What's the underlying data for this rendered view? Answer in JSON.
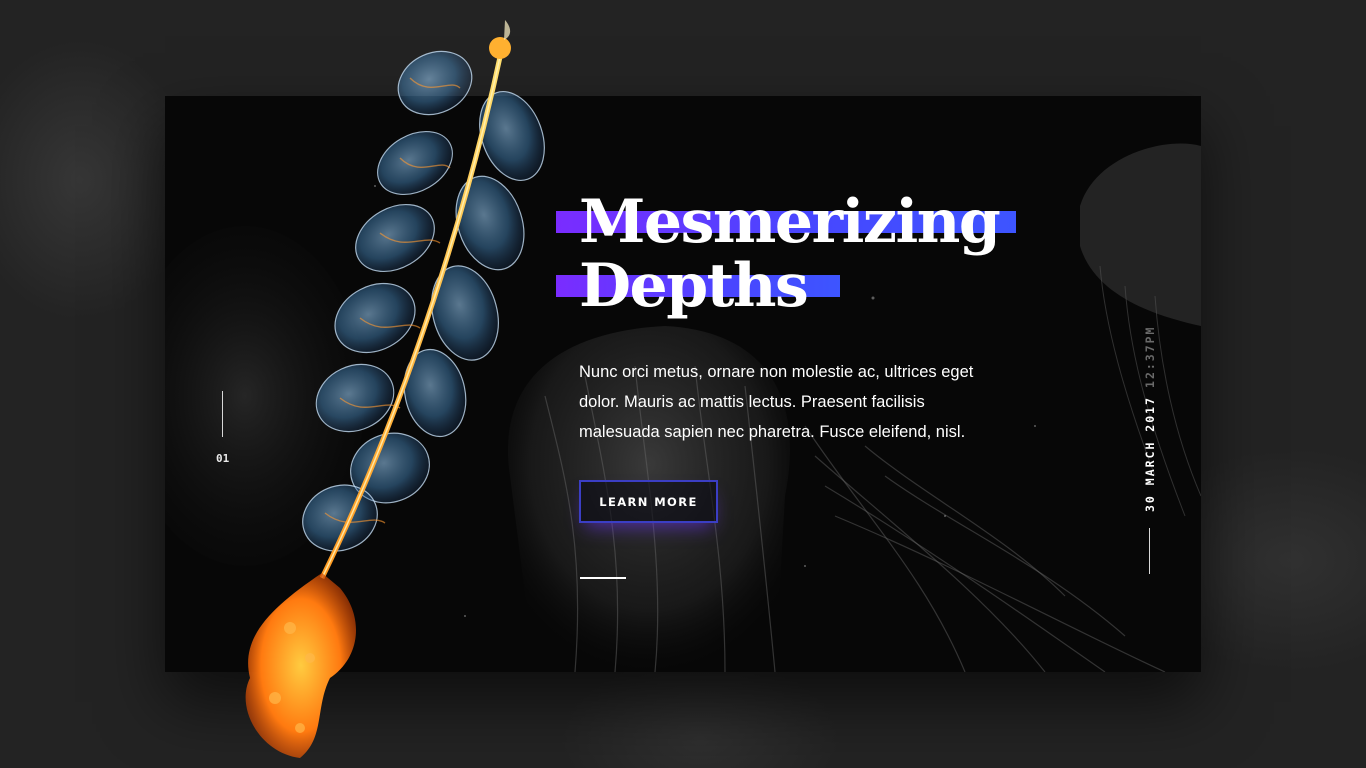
{
  "slide": {
    "number": "01"
  },
  "hero": {
    "headline_line1": "Mesmerizing",
    "headline_line2": "Depths",
    "body": "Nunc orci metus, ornare non molestie ac, ultrices eget dolor. Mauris ac mattis lectus. Praesent facilisis malesuada sapien nec pharetra. Fusce eleifend, nisl.",
    "cta_label": "LEARN MORE"
  },
  "meta": {
    "date": "30 MARCH 2017",
    "time": "12:37PM"
  },
  "colors": {
    "highlight_start": "#7a2cff",
    "highlight_end": "#3d55ff",
    "button_border": "#3b3ec4",
    "creature_glow": "#ffb020",
    "card_background": "#070707",
    "page_background": "#232323"
  },
  "icons": {
    "hero_image": "siphonophore-illustration",
    "background": "jellyfish-illustration"
  }
}
